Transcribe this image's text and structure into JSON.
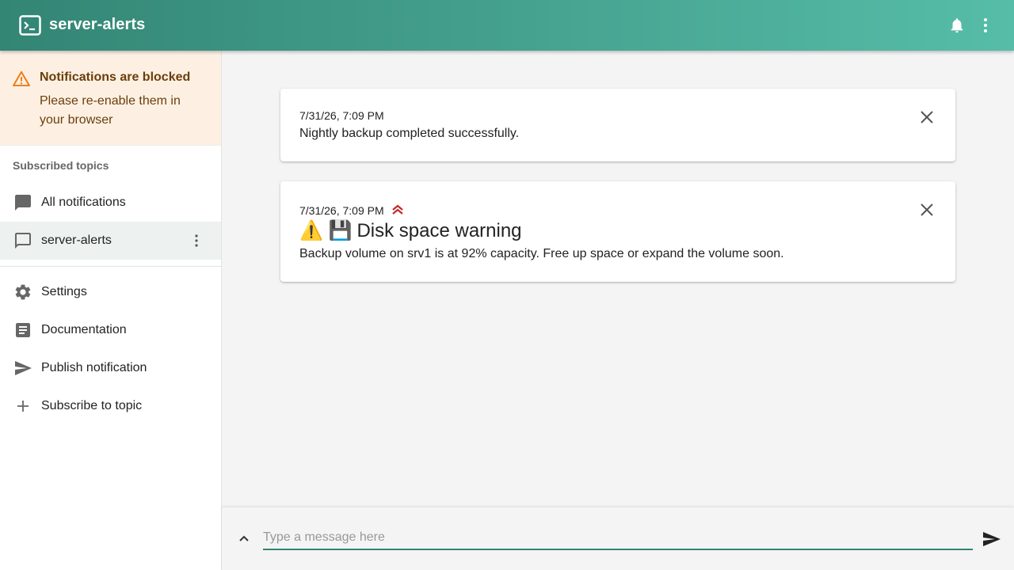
{
  "app": {
    "title": "server-alerts",
    "colors": {
      "primary": "#338574",
      "primary_light": "#56bda8",
      "warning_bg": "#fdf0e3",
      "priority": "#c62828"
    }
  },
  "header": {
    "icons": [
      "terminal-icon",
      "bell-icon",
      "more-vert-icon"
    ]
  },
  "sidebar": {
    "alert": {
      "title": "Notifications are blocked",
      "text": "Please re-enable them in your browser",
      "icon": "warning-icon"
    },
    "section_label": "Subscribed topics",
    "topics": [
      {
        "label": "All notifications",
        "icon": "chat-icon"
      },
      {
        "label": "server-alerts",
        "icon": "chat-outline-icon",
        "selected": true
      }
    ],
    "menu": [
      {
        "label": "Settings",
        "icon": "gear-icon"
      },
      {
        "label": "Documentation",
        "icon": "article-icon"
      },
      {
        "label": "Publish notification",
        "icon": "send-icon"
      },
      {
        "label": "Subscribe to topic",
        "icon": "plus-icon"
      }
    ]
  },
  "notifications": [
    {
      "date": "7/31/26, 7:09 PM",
      "message": "Nightly backup completed successfully."
    },
    {
      "date": "7/31/26, 7:09 PM",
      "title_emoji": "⚠️ 💾",
      "title": "Disk space warning",
      "message": "Backup volume on srv1 is at 92% capacity. Free up space or expand the volume soon.",
      "priority": "high"
    }
  ],
  "composer": {
    "placeholder": "Type a message here"
  }
}
